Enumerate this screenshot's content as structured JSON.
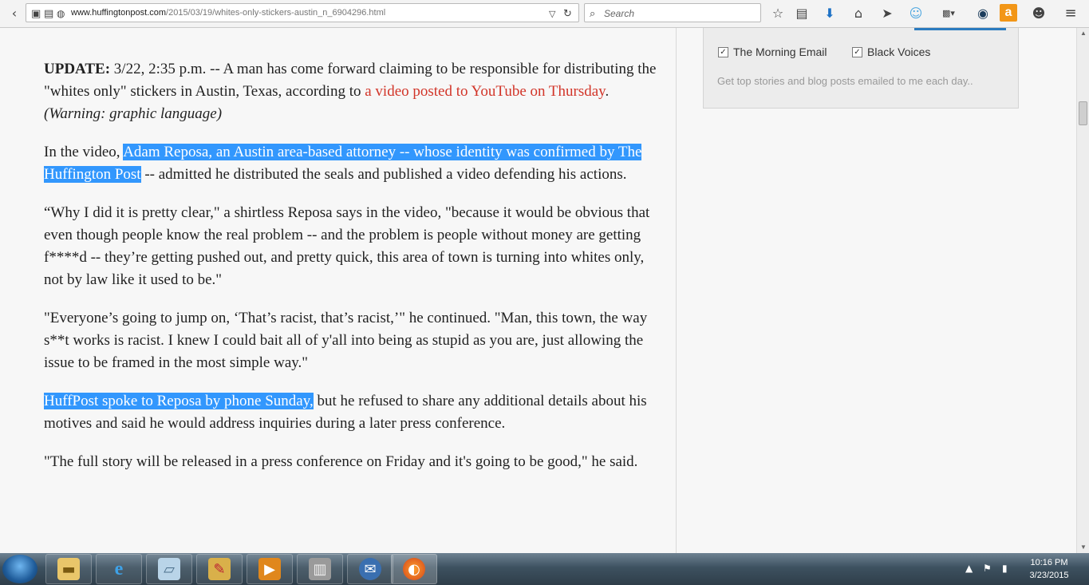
{
  "browser": {
    "url_host": "www.huffingtonpost.com",
    "url_path": "/2015/03/19/whites-only-stickers-austin_n_6904296.html",
    "search_placeholder": "Search",
    "toolbar_icons": [
      "bookmark-star-icon",
      "reading-list-icon",
      "download-icon",
      "home-icon",
      "send-icon",
      "ghostery-icon",
      "adblock-icon",
      "shield-icon",
      "amazon-icon",
      "chat-icon",
      "menu-icon"
    ]
  },
  "article": {
    "p1": {
      "label": "UPDATE:",
      "text": " 3/22, 2:35 p.m. -- A man has come forward claiming to be responsible for distributing the \"whites only\" stickers in Austin, Texas, according to ",
      "link": "a video posted to YouTube on Thursday",
      "after": ". ",
      "note": "(Warning: graphic language)"
    },
    "p2": {
      "before": "In the video, ",
      "selected": "Adam Reposa, an Austin area-based attorney -- whose identity was confirmed by The Huffington Post",
      "after": " -- admitted he distributed the seals and published a video defending his actions."
    },
    "p3": "“Why I did it is pretty clear,\" a shirtless Reposa says in the video, \"because it would be obvious that even though people know the real problem -- and the problem is people without money are getting f****d -- they’re getting pushed out, and pretty quick, this area of town is turning into whites only, not by law like it used to be.\"",
    "p4": "\"Everyone’s going to jump on, ‘That’s racist, that’s racist,’\" he continued. \"Man, this town, the way s**t works is racist. I knew I could bait all of y'all into being as stupid as you are, just allowing the issue to be framed in the most simple way.\"",
    "p5": {
      "selected": "HuffPost spoke to Reposa by phone Sunday,",
      "after": " but he refused to share any additional details about his motives and said he would address inquiries during a later press conference."
    },
    "p6": "\"The full story will be released in a press conference on Friday and it's going to be good,\" he said."
  },
  "newsletter": {
    "option1": "The Morning Email",
    "option2": "Black Voices",
    "description": "Get top stories and blog posts emailed to me each day.."
  },
  "taskbar": {
    "apps": [
      "file-explorer",
      "internet-explorer",
      "notepad",
      "paint",
      "media-player",
      "file-cabinet",
      "thunderbird",
      "firefox"
    ],
    "time": "10:16 PM",
    "date": "3/23/2015"
  },
  "colors": {
    "link": "#d23529",
    "selection": "#3297fd"
  }
}
